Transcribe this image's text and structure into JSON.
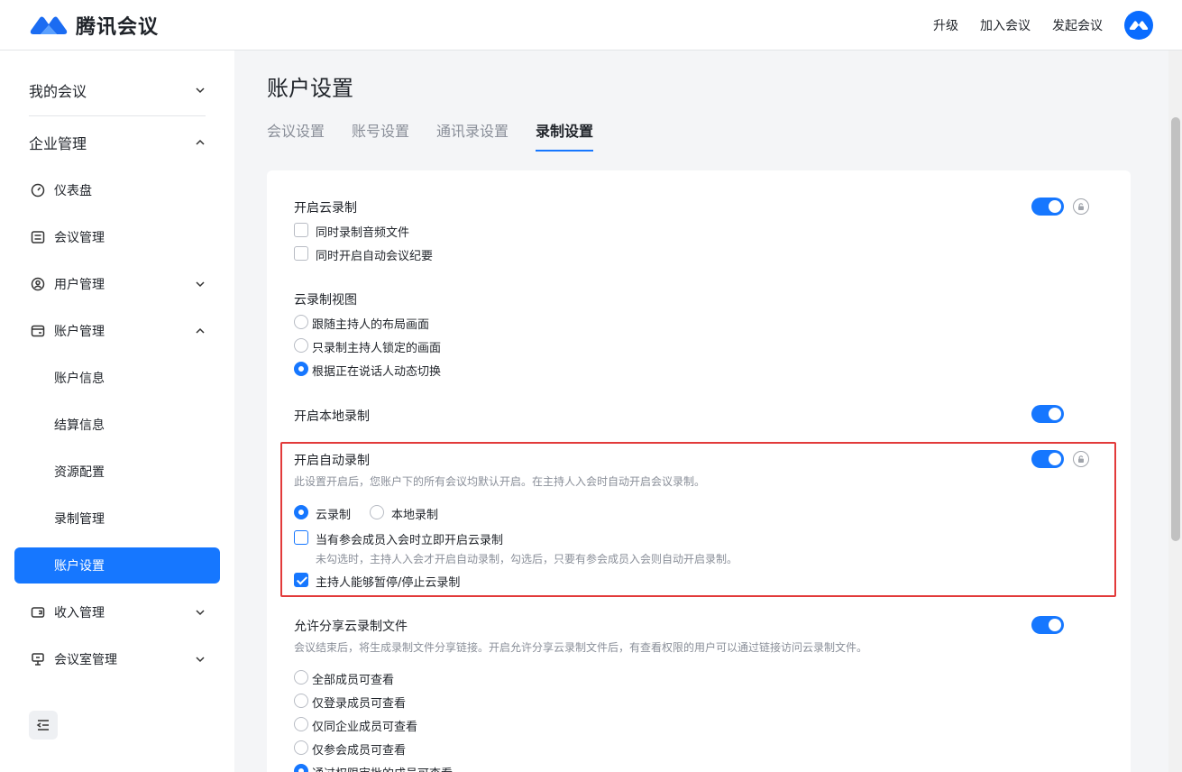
{
  "header": {
    "brand": "腾讯会议",
    "links": [
      "升级",
      "加入会议",
      "发起会议"
    ]
  },
  "sidebar": {
    "my_meetings": "我的会议",
    "enterprise": "企业管理",
    "items": [
      {
        "label": "仪表盘",
        "icon": "dashboard-icon"
      },
      {
        "label": "会议管理",
        "icon": "list-icon"
      },
      {
        "label": "用户管理",
        "icon": "user-icon"
      },
      {
        "label": "账户管理",
        "icon": "wallet-icon"
      }
    ],
    "sub_items": [
      "账户信息",
      "结算信息",
      "资源配置",
      "录制管理",
      "账户设置"
    ],
    "bottom_items": [
      {
        "label": "收入管理",
        "icon": "income-icon"
      },
      {
        "label": "会议室管理",
        "icon": "meeting-room-icon"
      }
    ]
  },
  "page": {
    "title": "账户设置",
    "tabs": [
      "会议设置",
      "账号设置",
      "通讯录设置",
      "录制设置"
    ],
    "active_tab": "录制设置"
  },
  "settings": {
    "cloud_record": {
      "label": "开启云录制",
      "enabled": true,
      "options": [
        "同时录制音频文件",
        "同时开启自动会议纪要"
      ]
    },
    "cloud_view": {
      "label": "云录制视图",
      "options": [
        "跟随主持人的布局画面",
        "只录制主持人锁定的画面",
        "根据正在说话人动态切换"
      ],
      "selected": "根据正在说话人动态切换"
    },
    "local_record": {
      "label": "开启本地录制",
      "enabled": true
    },
    "auto_record": {
      "label": "开启自动录制",
      "enabled": true,
      "desc": "此设置开启后，您账户下的所有会议均默认开启。在主持人入会时自动开启会议录制。",
      "radio_options": [
        "云录制",
        "本地录制"
      ],
      "selected": "云录制",
      "member_join": "当有参会成员入会时立即开启云录制",
      "member_join_desc": "未勾选时，主持人入会才开启自动录制，勾选后，只要有参会成员入会则自动开启录制。",
      "host_pause": "主持人能够暂停/停止云录制"
    },
    "share": {
      "label": "允许分享云录制文件",
      "enabled": true,
      "desc": "会议结束后，将生成录制文件分享链接。开启允许分享云录制文件后，有查看权限的用户可以通过链接访问云录制文件。",
      "options": [
        "全部成员可查看",
        "仅登录成员可查看",
        "仅同企业成员可查看",
        "仅参会成员可查看",
        "通过权限审批的成员可查看"
      ]
    }
  },
  "colors": {
    "accent": "#1677ff",
    "highlight": "#e23a3a"
  }
}
